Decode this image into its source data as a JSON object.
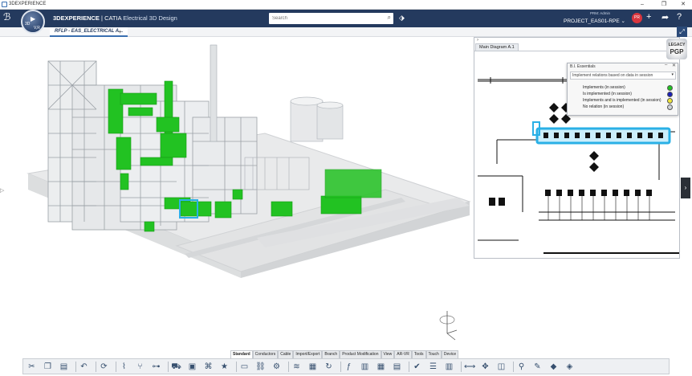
{
  "window": {
    "title": "3DEXPERIENCE",
    "controls": [
      "–",
      "❐",
      "✕"
    ]
  },
  "topbar": {
    "brand": "3DEXPERIENCE",
    "separator": " | ",
    "product": "CATIA",
    "app_name": " Electrical 3D Design",
    "compass_3d": "3D",
    "compass_v": "V,R",
    "search_placeholder": "Search",
    "user_sub": "PRM: Admin",
    "project": "PROJECT_EAS01-RPE",
    "project_caret": "⌄",
    "avatar": "PR"
  },
  "tabs": {
    "active": "RFLP - EAS_ELECTRICAL A...",
    "add": "+"
  },
  "diagram": {
    "arrow": "›",
    "tab": "Main Diagram A.1"
  },
  "legacy": {
    "line1": "LEGACY",
    "line2": "PGP"
  },
  "bi_panel": {
    "title": "B.I. Essentials",
    "dropdown": "Implement relations based on data in session",
    "legend": [
      {
        "label": "Implements (in session)",
        "color": "#22c222"
      },
      {
        "label": "Is implemented (in session)",
        "color": "#1a1fb8"
      },
      {
        "label": "Implements and is implemented (in session)",
        "color": "#f0e63a"
      },
      {
        "label": "No relation (in session)",
        "color": "#cfd3d8"
      }
    ]
  },
  "toolbar_tabs": [
    {
      "label": "Standard",
      "active": true
    },
    {
      "label": "Conductors"
    },
    {
      "label": "Cable"
    },
    {
      "label": "Import/Export"
    },
    {
      "label": "Branch"
    },
    {
      "label": "Product Modification"
    },
    {
      "label": "View"
    },
    {
      "label": "AR-VR"
    },
    {
      "label": "Tools"
    },
    {
      "label": "Touch"
    },
    {
      "label": "Device"
    }
  ],
  "toolbar_icons": [
    "scissors-icon",
    "copy-icon",
    "paste-icon",
    "sep",
    "undo-icon",
    "sep",
    "update-icon",
    "sep",
    "route-icon",
    "branch-icon",
    "connect-icon",
    "sep",
    "vehicle-icon",
    "device-icon",
    "harness-icon",
    "star-icon",
    "sep",
    "document-icon",
    "link-icon",
    "settings-icon",
    "sep",
    "cable-icon",
    "table-icon",
    "refresh-icon",
    "sep",
    "formula-icon",
    "catalog-icon",
    "grid-icon",
    "report-icon",
    "sep",
    "check-icon",
    "list-icon",
    "book-icon",
    "sep",
    "measure-icon",
    "compass-icon",
    "layers-icon",
    "sep",
    "screw-icon",
    "marker-icon",
    "cube-icon",
    "cube2-icon"
  ],
  "colors": {
    "topbar": "#243a5e",
    "accent": "#3a6fb0",
    "highlight": "#2ab0e6",
    "green": "#22c222"
  }
}
